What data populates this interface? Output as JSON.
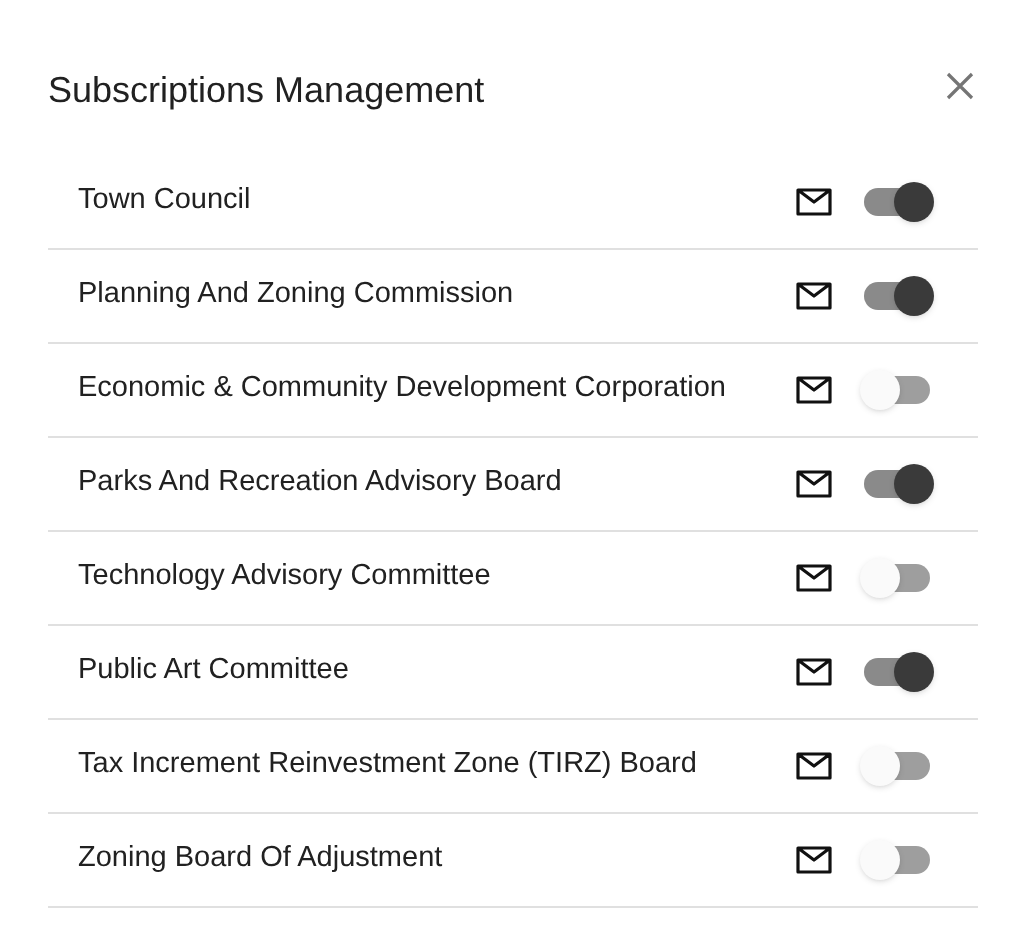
{
  "dialog": {
    "title": "Subscriptions Management"
  },
  "subscriptions": [
    {
      "name": "Town Council",
      "on": true
    },
    {
      "name": "Planning And Zoning Commission",
      "on": true
    },
    {
      "name": "Economic & Community Development Corporation",
      "on": false
    },
    {
      "name": "Parks And Recreation Advisory Board",
      "on": true
    },
    {
      "name": "Technology Advisory Committee",
      "on": false
    },
    {
      "name": "Public Art Committee",
      "on": true
    },
    {
      "name": "Tax Increment Reinvestment Zone (TIRZ) Board",
      "on": false
    },
    {
      "name": "Zoning Board Of Adjustment",
      "on": false
    }
  ]
}
